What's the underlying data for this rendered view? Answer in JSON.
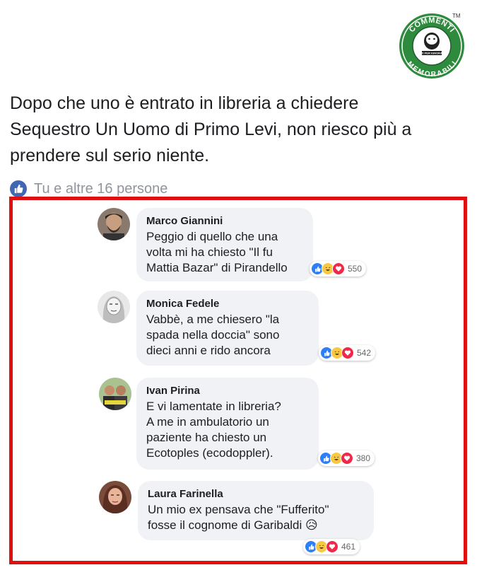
{
  "logo": {
    "top_text": "COMMENTI",
    "bottom_text": "MEMORABILI",
    "inner_text": "NATI PER IGNORARE",
    "trademark": "TM",
    "colors": {
      "ring": "#2e8b3e",
      "inner": "#ffffff"
    }
  },
  "post": {
    "text": "Dopo che uno è entrato in libreria a chiedere Sequestro Un Uomo di Primo Levi, non riesco più a prendere sul serio niente.",
    "likes_text": "Tu e altre 16 persone",
    "like_icon": "thumbs-up-icon"
  },
  "comments": [
    {
      "author": "Marco Giannini",
      "text": "Peggio di quello che una\nvolta mi ha chiesto \"Il fu\nMattia Bazar\" di Pirandello",
      "reaction_count": "550",
      "avatar_color": "#5a4a3e"
    },
    {
      "author": "Monica Fedele",
      "text": "Vabbè, a me chiesero \"la\nspada nella doccia\" sono\ndieci anni e rido ancora",
      "reaction_count": "542",
      "avatar_color": "#cfcfcf"
    },
    {
      "author": "Ivan Pirina",
      "text": "E vi lamentate in libreria?\nA me in ambulatorio un\npaziente ha chiesto un\nEcotoples (ecodoppler).",
      "reaction_count": "380",
      "avatar_color": "#6b8a5a"
    },
    {
      "author": "Laura Farinella",
      "text": "Un mio ex pensava che \"Fufferito\"\nfosse il cognome di Garibaldi 😥",
      "reaction_count": "461",
      "avatar_color": "#a6705a"
    }
  ],
  "colors": {
    "frame": "#e01010",
    "bubble": "#f0f2f5",
    "like_blue": "#4267b2"
  }
}
